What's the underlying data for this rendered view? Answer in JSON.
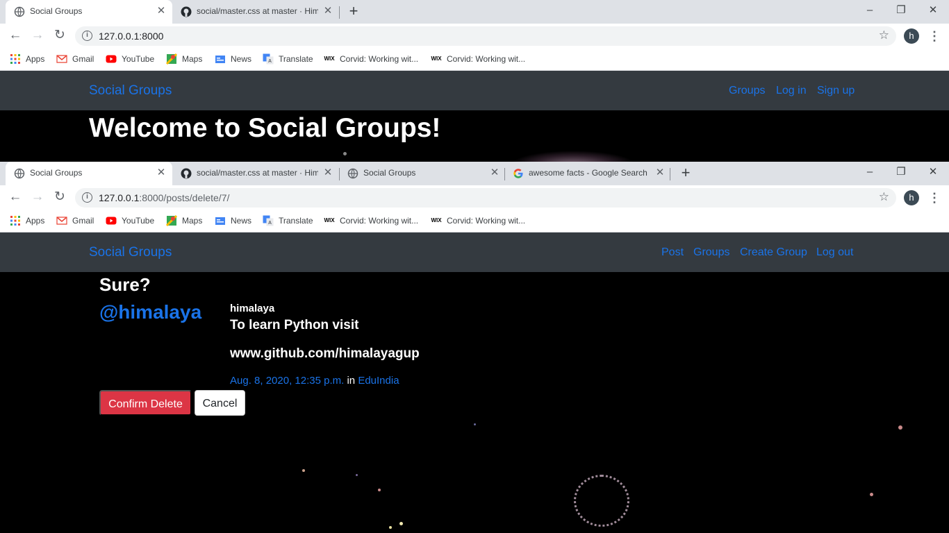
{
  "window1": {
    "tabs": [
      {
        "title": "Social Groups",
        "active": true
      },
      {
        "title": "social/master.css at master · Him",
        "active": false
      }
    ],
    "url": {
      "host": "127.0.0.1:8000",
      "path": ""
    },
    "app": {
      "brand": "Social Groups",
      "nav": [
        "Groups",
        "Log in",
        "Sign up"
      ]
    },
    "page": {
      "heading": "Welcome to Social Groups!"
    }
  },
  "window2": {
    "tabs": [
      {
        "title": "Social Groups",
        "active": true
      },
      {
        "title": "social/master.css at master · Him",
        "active": false
      },
      {
        "title": "Social Groups",
        "active": false
      },
      {
        "title": "awesome facts - Google Search",
        "active": false
      }
    ],
    "url": {
      "host": "127.0.0.1",
      "path": ":8000/posts/delete/7/"
    },
    "app": {
      "brand": "Social Groups",
      "nav": [
        "Post",
        "Groups",
        "Create Group",
        "Log out"
      ]
    },
    "page": {
      "question": "Sure?",
      "handle": "@himalaya",
      "post": {
        "author": "himalaya",
        "line1": "To learn Python visit",
        "line2": "www.github.com/himalayagup",
        "date": "Aug. 8, 2020, 12:35 p.m.",
        "in_word": "in",
        "group": "EduIndia"
      },
      "confirm_label": "Confirm Delete",
      "cancel_label": "Cancel"
    }
  },
  "bookmarks": [
    "Apps",
    "Gmail",
    "YouTube",
    "Maps",
    "News",
    "Translate",
    "Corvid: Working wit...",
    "Corvid: Working wit..."
  ],
  "profile_initial": "h",
  "colors": {
    "link": "#1a73e8",
    "navbar": "#343a40",
    "danger": "#dc3545",
    "tabbar": "#dee1e6"
  }
}
